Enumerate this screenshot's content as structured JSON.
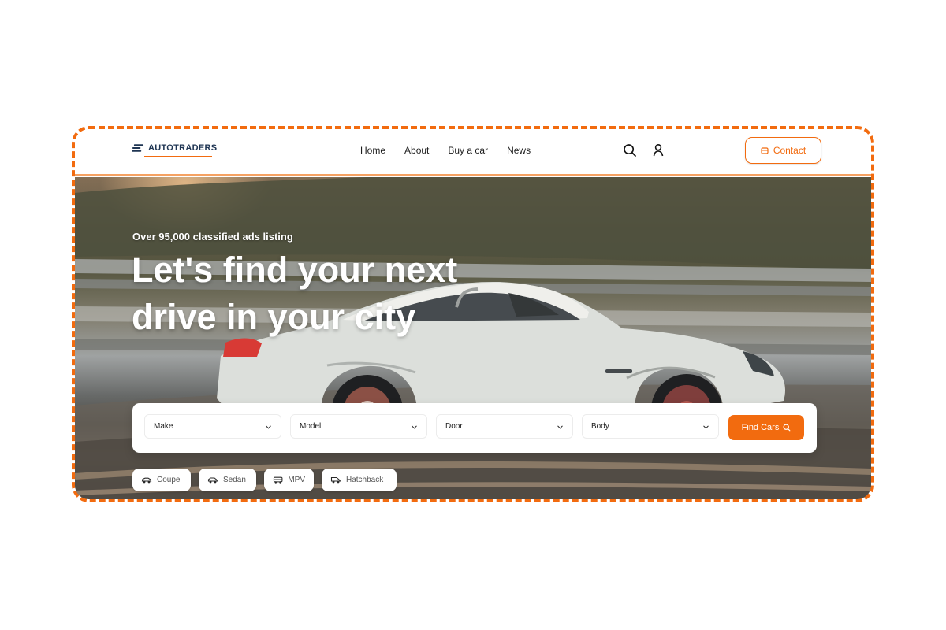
{
  "brand": {
    "name": "AUTOTRADERS",
    "accent": "#f26b0f",
    "navy": "#1f3553"
  },
  "nav": {
    "items": [
      {
        "label": "Home"
      },
      {
        "label": "About"
      },
      {
        "label": "Buy a car"
      },
      {
        "label": "News"
      }
    ],
    "icons": [
      "search-icon",
      "user-icon"
    ],
    "contact_label": "Contact",
    "contact_icon": "message-icon"
  },
  "hero": {
    "eyebrow": "Over 95,000 classified ads listing",
    "headline_line1": "Let's find your next",
    "headline_line2": "drive in your city"
  },
  "search": {
    "filters": [
      {
        "label": "Make"
      },
      {
        "label": "Model"
      },
      {
        "label": "Door"
      },
      {
        "label": "Body"
      }
    ],
    "button_label": "Find Cars",
    "button_icon": "search-icon"
  },
  "body_types": [
    {
      "label": "Coupe",
      "icon": "coupe-car-icon"
    },
    {
      "label": "Sedan",
      "icon": "sedan-car-icon"
    },
    {
      "label": "MPV",
      "icon": "van-icon"
    },
    {
      "label": "Hatchback",
      "icon": "hatchback-car-icon"
    }
  ]
}
